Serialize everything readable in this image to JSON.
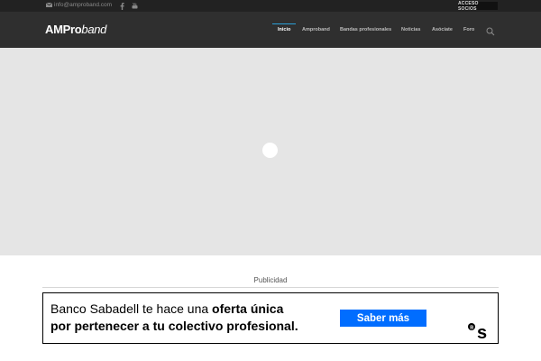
{
  "topbar": {
    "email": "info@amproband.com",
    "social_icons": [
      "facebook-icon",
      "youtube-icon"
    ],
    "socios_label": "ACCESO SOCIOS"
  },
  "header": {
    "logo_amp": "AMPro",
    "logo_band": "band",
    "nav": [
      {
        "label": "Inicio",
        "active": true
      },
      {
        "label": "Amproband",
        "active": false
      },
      {
        "label": "Bandas profesionales",
        "active": false
      },
      {
        "label": "Noticias",
        "active": false
      },
      {
        "label": "Asóciate",
        "active": false
      },
      {
        "label": "Foro",
        "active": false
      }
    ],
    "search_icon": "search-icon",
    "accent_color": "#2a9fd6"
  },
  "hero": {
    "background": "#e5e5e5"
  },
  "ad": {
    "label": "Publicidad",
    "line1_prefix": "Banco Sabadell te hace una ",
    "line1_bold": "oferta única",
    "line2": "por pertenecer a tu colectivo profesional.",
    "cta": "Saber más",
    "cta_color": "#006dff",
    "brand_icon": "banco-sabadell-logo"
  }
}
